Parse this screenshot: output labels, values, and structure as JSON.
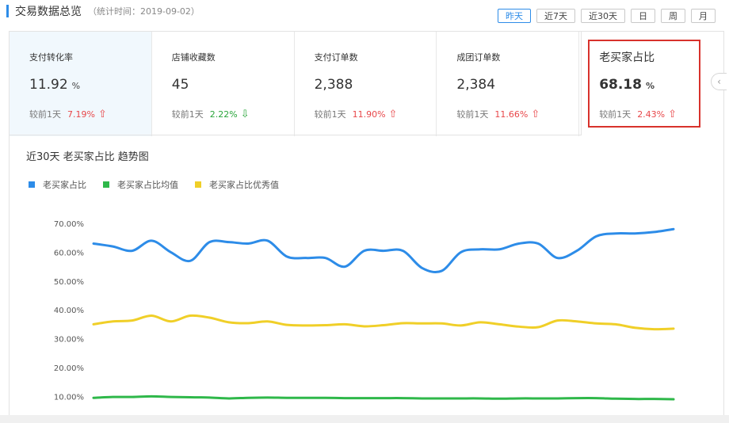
{
  "header": {
    "title": "交易数据总览",
    "meta": "（统计时间：2019-09-02）"
  },
  "range_buttons": [
    "昨天",
    "近7天",
    "近30天",
    "日",
    "周",
    "月"
  ],
  "active_range": "昨天",
  "metrics": [
    {
      "label": "支付转化率",
      "value": "11.92",
      "unit": "%",
      "compare_label": "较前1天",
      "pct": "7.19%",
      "trend": "up"
    },
    {
      "label": "店铺收藏数",
      "value": "45",
      "unit": "",
      "compare_label": "较前1天",
      "pct": "2.22%",
      "trend": "down"
    },
    {
      "label": "支付订单数",
      "value": "2,388",
      "unit": "",
      "compare_label": "较前1天",
      "pct": "11.90%",
      "trend": "up"
    },
    {
      "label": "成团订单数",
      "value": "2,384",
      "unit": "",
      "compare_label": "较前1天",
      "pct": "11.66%",
      "trend": "up"
    },
    {
      "label": "老买家占比",
      "value": "68.18",
      "unit": "%",
      "compare_label": "较前1天",
      "pct": "2.43%",
      "trend": "up"
    }
  ],
  "colors": {
    "accent": "#2d8ce8",
    "up": "#e8474a",
    "down": "#2aa53b",
    "highlight": "#d8322c"
  },
  "icons": {
    "up": "arrow-up-icon",
    "down": "arrow-down-icon",
    "collapse": "chevron-left-icon"
  },
  "chart_title": "近30天 老买家占比 趋势图",
  "chart_data": {
    "type": "line",
    "title": "近30天 老买家占比 趋势图",
    "xlabel": "",
    "ylabel": "",
    "yticks": [
      "70.00%",
      "60.00%",
      "50.00%",
      "40.00%",
      "30.00%",
      "20.00%",
      "10.00%"
    ],
    "ylim": [
      0,
      70
    ],
    "grid": false,
    "legend_position": "top-left",
    "points": 31,
    "series": [
      {
        "name": "老买家占比",
        "color": "#2d8ce8",
        "values": [
          63,
          62,
          60.5,
          64,
          60,
          57,
          63.5,
          63.5,
          63,
          64,
          58.5,
          58,
          58,
          55,
          60.5,
          60.5,
          60.5,
          54.5,
          53.5,
          60,
          61,
          61,
          63,
          63,
          58,
          60.5,
          65.5,
          66.5,
          66.5,
          67,
          68
        ]
      },
      {
        "name": "老买家占比均值",
        "color": "#2fb84a",
        "values": [
          9.5,
          9.8,
          9.8,
          10,
          9.8,
          9.7,
          9.6,
          9.3,
          9.5,
          9.6,
          9.5,
          9.5,
          9.5,
          9.4,
          9.4,
          9.4,
          9.4,
          9.3,
          9.3,
          9.3,
          9.3,
          9.2,
          9.3,
          9.3,
          9.3,
          9.4,
          9.4,
          9.2,
          9.1,
          9.1,
          9.0
        ]
      },
      {
        "name": "老买家占比优秀值",
        "color": "#f0cf28",
        "values": [
          35,
          36,
          36.3,
          38,
          36,
          38,
          37.3,
          35.7,
          35.4,
          36,
          34.8,
          34.6,
          34.7,
          35,
          34.3,
          34.7,
          35.4,
          35.3,
          35.3,
          34.6,
          35.7,
          35,
          34.2,
          34,
          36.3,
          36,
          35.3,
          35,
          33.8,
          33.3,
          33.5
        ]
      }
    ]
  }
}
